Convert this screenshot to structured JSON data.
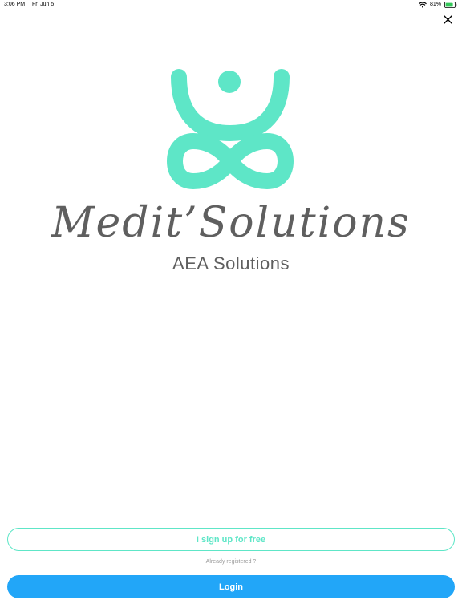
{
  "status_bar": {
    "time": "3:06 PM",
    "date": "Fri Jun 5",
    "battery": "81%",
    "icons": [
      "wifi-icon",
      "battery-icon"
    ]
  },
  "close_icon": "close-icon",
  "brand": {
    "logo": "meditation-logo",
    "name": "Medit’Solutions",
    "subtitle": "AEA Solutions",
    "accent_color": "#5ee6c7",
    "text_color": "#5f5f5f"
  },
  "actions": {
    "signup_label": "I sign up for free",
    "already_label": "Already registered ?",
    "login_label": "Login",
    "login_color": "#22a6f8"
  }
}
